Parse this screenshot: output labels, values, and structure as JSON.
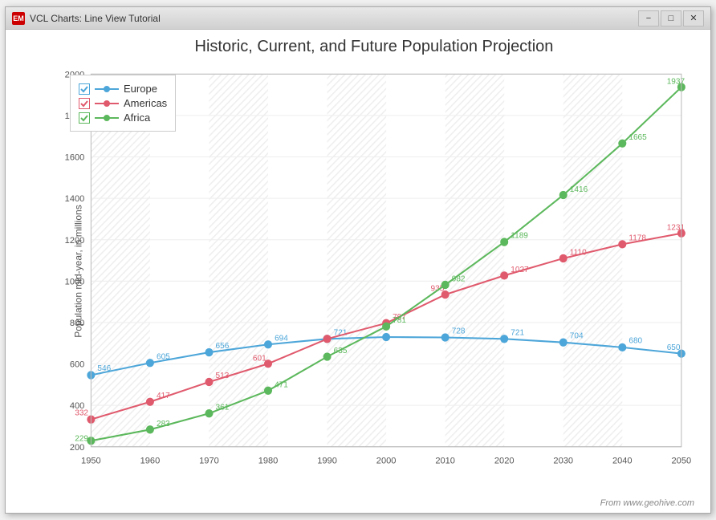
{
  "window": {
    "title": "VCL Charts: Line View Tutorial",
    "icon_label": "EM"
  },
  "title_bar_buttons": {
    "minimize": "−",
    "maximize": "□",
    "close": "✕"
  },
  "chart": {
    "title": "Historic, Current, and Future Population Projection",
    "y_axis_label": "Population mid-year, in millions",
    "source_label": "From www.geohive.com",
    "x_axis": [
      "1950",
      "1960",
      "1970",
      "1980",
      "1990",
      "2000",
      "2010",
      "2020",
      "2030",
      "2040",
      "2050"
    ],
    "y_axis": [
      "200",
      "400",
      "600",
      "800",
      "1000",
      "1200",
      "1400",
      "1600",
      "1800",
      "2000"
    ],
    "legend": [
      {
        "label": "Europe",
        "color": "#4da6d9",
        "check_color": "#4da6d9"
      },
      {
        "label": "Americas",
        "color": "#e05a6d",
        "check_color": "#e05a6d"
      },
      {
        "label": "Africa",
        "color": "#5cb85c",
        "check_color": "#5cb85c"
      }
    ],
    "series": {
      "europe": {
        "color": "#4da6d9",
        "points": [
          {
            "x": 1950,
            "y": 546,
            "label": "546"
          },
          {
            "x": 1960,
            "y": 605,
            "label": "605"
          },
          {
            "x": 1970,
            "y": 656,
            "label": "656"
          },
          {
            "x": 1980,
            "y": 694,
            "label": "694"
          },
          {
            "x": 1990,
            "y": 721,
            "label": "721"
          },
          {
            "x": 2000,
            "y": 730,
            "label": ""
          },
          {
            "x": 2010,
            "y": 728,
            "label": "728"
          },
          {
            "x": 2020,
            "y": 721,
            "label": "721"
          },
          {
            "x": 2030,
            "y": 704,
            "label": "704"
          },
          {
            "x": 2040,
            "y": 680,
            "label": "680"
          },
          {
            "x": 2050,
            "y": 650,
            "label": "650"
          }
        ]
      },
      "americas": {
        "color": "#e05a6d",
        "points": [
          {
            "x": 1950,
            "y": 332,
            "label": "332"
          },
          {
            "x": 1960,
            "y": 417,
            "label": "417"
          },
          {
            "x": 1970,
            "y": 513,
            "label": "513"
          },
          {
            "x": 1980,
            "y": 601,
            "label": "601"
          },
          {
            "x": 1990,
            "y": 721,
            "label": ""
          },
          {
            "x": 2000,
            "y": 797,
            "label": "797"
          },
          {
            "x": 2010,
            "y": 935,
            "label": "935"
          },
          {
            "x": 2020,
            "y": 1027,
            "label": "1027"
          },
          {
            "x": 2030,
            "y": 1110,
            "label": "1110"
          },
          {
            "x": 2040,
            "y": 1178,
            "label": "1178"
          },
          {
            "x": 2050,
            "y": 1231,
            "label": "1231"
          }
        ]
      },
      "africa": {
        "color": "#5cb85c",
        "points": [
          {
            "x": 1950,
            "y": 229,
            "label": "229"
          },
          {
            "x": 1960,
            "y": 283,
            "label": "283"
          },
          {
            "x": 1970,
            "y": 361,
            "label": "361"
          },
          {
            "x": 1980,
            "y": 471,
            "label": "471"
          },
          {
            "x": 1990,
            "y": 635,
            "label": "635"
          },
          {
            "x": 2000,
            "y": 781,
            "label": "781"
          },
          {
            "x": 2010,
            "y": 982,
            "label": "982"
          },
          {
            "x": 2020,
            "y": 1189,
            "label": "1189"
          },
          {
            "x": 2030,
            "y": 1416,
            "label": "1416"
          },
          {
            "x": 2040,
            "y": 1665,
            "label": "1665"
          },
          {
            "x": 2050,
            "y": 1937,
            "label": "1937"
          }
        ]
      }
    }
  }
}
